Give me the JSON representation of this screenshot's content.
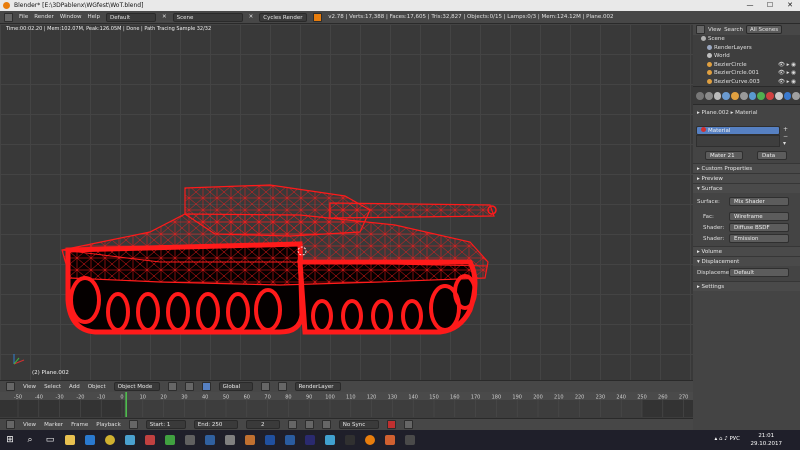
{
  "window": {
    "title": "Blender* [E:\\3DPablenx\\WGfest\\WoT.blend]",
    "controls": [
      "—",
      "☐",
      "✕"
    ]
  },
  "infobar": {
    "menus": [
      "File",
      "Render",
      "Window",
      "Help"
    ],
    "layout": "Default",
    "scene": "Scene",
    "engine": "Cycles Render",
    "stats": "v2.78 | Verts:17,388 | Faces:17,605 | Tris:32,827 | Objects:0/15 | Lamps:0/3 | Mem:124.12M | Plane.002"
  },
  "viewport": {
    "status": "Time:00:02.20 | Mem:102.07M, Peak:126.05M | Done | Path Tracing Sample 32/32",
    "object_label": "(2) Plane.002"
  },
  "vpheader": {
    "menus": [
      "View",
      "Select",
      "Add",
      "Object"
    ],
    "mode": "Object Mode",
    "orientation": "Global",
    "render_layer": "RenderLayer"
  },
  "timeline": {
    "ticks": [
      "-50",
      "-40",
      "-30",
      "-20",
      "-10",
      "0",
      "10",
      "20",
      "30",
      "40",
      "50",
      "60",
      "70",
      "80",
      "90",
      "100",
      "110",
      "120",
      "130",
      "140",
      "150",
      "160",
      "170",
      "180",
      "190",
      "200",
      "210",
      "220",
      "230",
      "240",
      "250",
      "260",
      "270",
      "280"
    ],
    "menus": [
      "View",
      "Marker",
      "Frame",
      "Playback"
    ],
    "start_label": "Start:",
    "start": "1",
    "end_label": "End:",
    "end": "250",
    "current": "2",
    "sync": "No Sync"
  },
  "outliner": {
    "tabs": [
      "View",
      "Search",
      "All Scenes"
    ],
    "rows": [
      {
        "label": "Scene",
        "color": "#b0b0b0"
      },
      {
        "label": "RenderLayers",
        "color": "#9aa7c0"
      },
      {
        "label": "World",
        "color": "#c0c0c0"
      },
      {
        "label": "BezierCircle",
        "color": "#e0a040"
      },
      {
        "label": "BezierCircle.001",
        "color": "#e0a040"
      },
      {
        "label": "BezierCurve.003",
        "color": "#e0a040"
      }
    ]
  },
  "properties": {
    "breadcrumb_object": "Plane.002",
    "breadcrumb_material": "Material",
    "material_slot": "Material",
    "datablock": "Mater",
    "users": "21",
    "link": "Data",
    "panels": {
      "custom_properties": "Custom Properties",
      "preview": "Preview",
      "surface": "Surface",
      "volume": "Volume",
      "displacement": "Displacement",
      "settings": "Settings"
    },
    "surface_label": "Surface:",
    "surface_value": "Mix Shader",
    "fac_label": "Fac:",
    "fac_value": "Wireframe",
    "shader1_label": "Shader:",
    "shader1_value": "Diffuse BSDF",
    "shader2_label": "Shader:",
    "shader2_value": "Emission",
    "displacement_label": "Displacement:",
    "displacement_value": "Default"
  },
  "taskbar": {
    "lang": "РУС",
    "time": "21:01",
    "date": "29.10.2017"
  },
  "colors": {
    "wire": "#ff1a1a",
    "accent": "#5680c2",
    "blender_orange": "#e87d0d"
  }
}
